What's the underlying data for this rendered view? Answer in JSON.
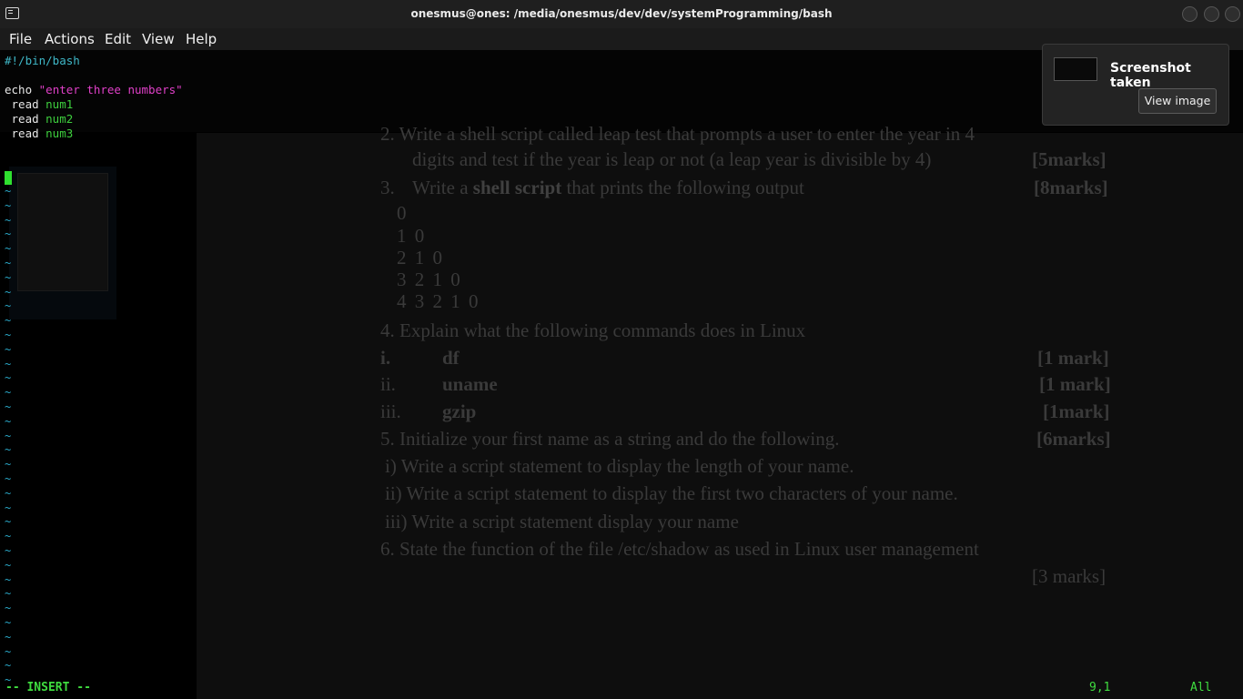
{
  "window": {
    "title": "onesmus@ones: /media/onesmus/dev/dev/systemProgramming/bash"
  },
  "menu": [
    "File",
    "Actions",
    "Edit",
    "View",
    "Help"
  ],
  "editor": {
    "lines": {
      "shebang": "#!/bin/bash",
      "echo_cmd": "echo ",
      "echo_str": "\"enter three numbers\"",
      "read1_cmd": " read ",
      "read1_var": "num1",
      "read2_cmd": " read ",
      "read2_var": "num2",
      "read3_cmd": " read ",
      "read3_var": "num3"
    },
    "tilde": "~",
    "mode": "-- INSERT --",
    "position": "9,1",
    "scroll": "All"
  },
  "background_document": {
    "q2_line1": "2.   Write a shell script called leap test that prompts a user to enter the year in 4",
    "q2_line2": "digits and test if the year is leap or not (a leap year is divisible by 4)",
    "q2_marks": "[5marks]",
    "q3_num": "3.",
    "q3_pre": "Write a ",
    "q3_bold": "shell script",
    "q3_post": " that prints the following output",
    "q3_marks": "[8marks]",
    "pattern": [
      "0",
      "1 0",
      "2 1 0",
      "3 2 1 0",
      "4 3 2 1 0"
    ],
    "q4": "4.   Explain what the following commands does in Linux",
    "q4_items": [
      {
        "num": "i.",
        "cmd": "df",
        "marks": "[1 mark]"
      },
      {
        "num": "ii.",
        "cmd": "uname",
        "marks": "[1 mark]"
      },
      {
        "num": "iii.",
        "cmd": "gzip",
        "marks": "[1mark]"
      }
    ],
    "q5": "5.   Initialize your first name as a string and do the following.",
    "q5_marks": "[6marks]",
    "q5_items": [
      "i)        Write a script statement to display the length of your name.",
      "ii)        Write a script statement to display the first two characters of your name.",
      "iii)       Write a script statement display your name"
    ],
    "q6": "6.   State the function of the file /etc/shadow as used in Linux user management",
    "q6_marks": "[3 marks]"
  },
  "notification": {
    "title": "Screenshot taken",
    "button": "View image"
  }
}
